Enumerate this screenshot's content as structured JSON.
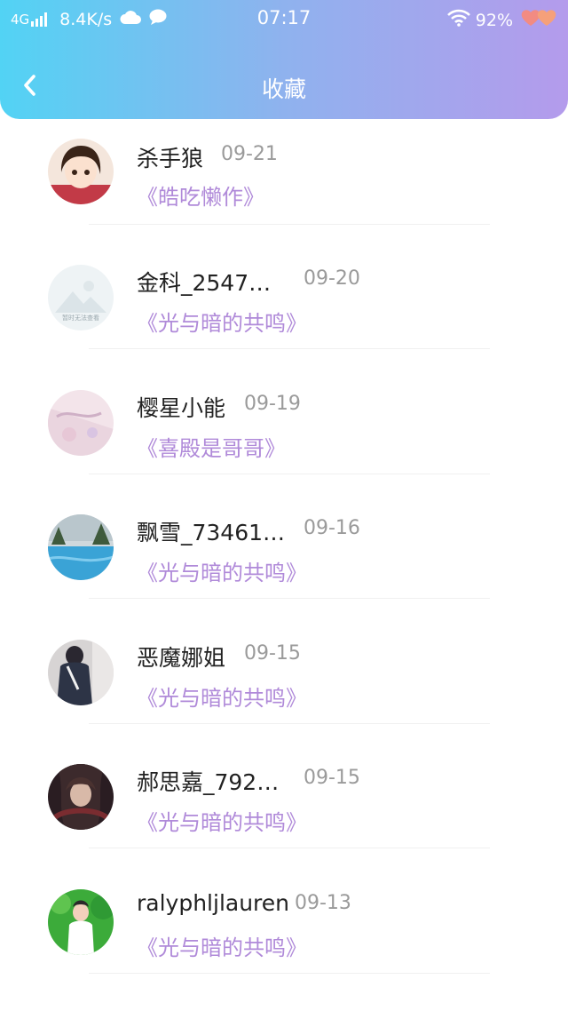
{
  "status_bar": {
    "network": "4G",
    "speed": "8.4K/s",
    "time": "07:17",
    "battery": "92%"
  },
  "nav": {
    "title": "收藏",
    "back_icon": "chevron-left-icon"
  },
  "items": [
    {
      "name": "杀手狼",
      "date": "09-21",
      "title": "《皓吃懒作》"
    },
    {
      "name": "金科_2547…",
      "date": "09-20",
      "title": "《光与暗的共鸣》",
      "avatar_text": "暂时无法查看"
    },
    {
      "name": "樱星小能",
      "date": "09-19",
      "title": "《喜殿是哥哥》"
    },
    {
      "name": "飘雪_73461…",
      "date": "09-16",
      "title": "《光与暗的共鸣》"
    },
    {
      "name": "恶魔娜姐",
      "date": "09-15",
      "title": "《光与暗的共鸣》"
    },
    {
      "name": "郝思嘉_792…",
      "date": "09-15",
      "title": "《光与暗的共鸣》"
    },
    {
      "name": "ralyphljlauren",
      "date": "09-13",
      "title": "《光与暗的共鸣》"
    }
  ],
  "colors": {
    "header_gradient_start": "#52d3f4",
    "header_gradient_end": "#b49bec",
    "book_title": "#b08ad9",
    "date": "#9a9a9a"
  }
}
